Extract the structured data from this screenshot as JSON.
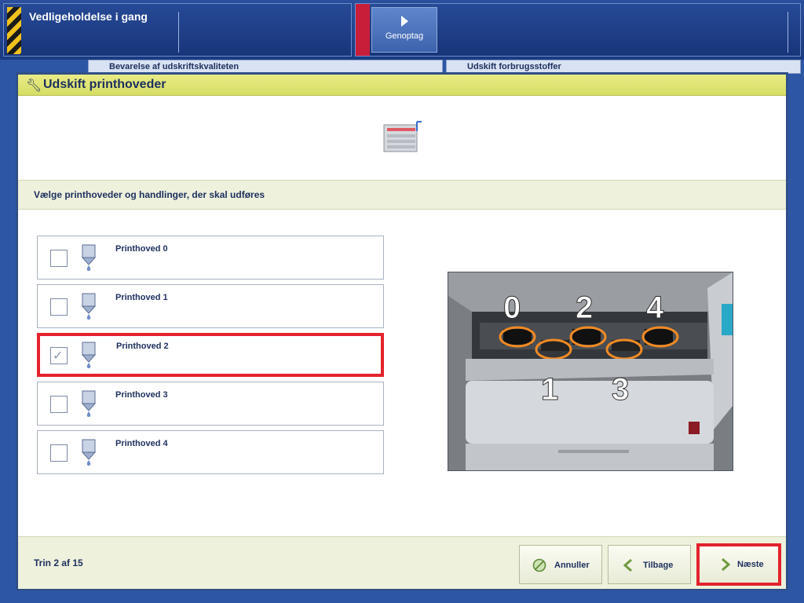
{
  "topbar": {
    "status_text": "Vedligeholdelse i gang",
    "resume_label": "Genoptag"
  },
  "background": {
    "tab_left": "Bevarelse af udskriftskvaliteten",
    "tab_right": "Udskift forbrugsstoffer"
  },
  "dialog": {
    "title": "Udskift printhoveder",
    "instruction": "Vælge printhoveder og handlinger, der skal udføres",
    "printheads": [
      {
        "label": "Printhoved 0",
        "checked": false
      },
      {
        "label": "Printhoved 1",
        "checked": false
      },
      {
        "label": "Printhoved 2",
        "checked": true
      },
      {
        "label": "Printhoved 3",
        "checked": false
      },
      {
        "label": "Printhoved 4",
        "checked": false
      }
    ],
    "photo_numbers": [
      "0",
      "2",
      "4",
      "1",
      "3"
    ],
    "step": "Trin 2 af 15",
    "buttons": {
      "cancel": "Annuller",
      "back": "Tilbage",
      "next": "Næste"
    }
  },
  "colors": {
    "title_bar": "#dde26f",
    "highlight": "#e3232d",
    "text": "#1c2f5e",
    "frame": "#2f4f87"
  }
}
